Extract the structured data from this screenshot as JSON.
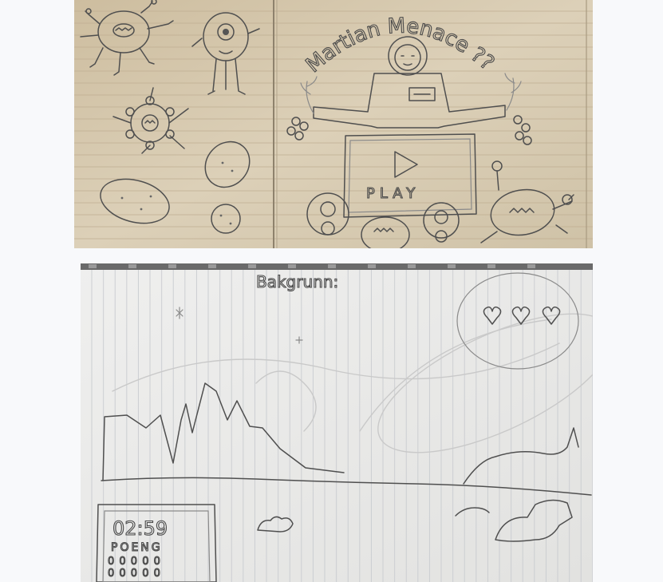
{
  "top_sketch": {
    "title": "Martian Menace ???",
    "play_label": "PLAY"
  },
  "bottom_sketch": {
    "heading": "Bakgrunn:",
    "timer": "02:59",
    "score_label": "POENG",
    "score_row_1": "0 0 0 0 0",
    "score_row_2": "0 0 0 0 0"
  },
  "colors": {
    "paper_warm": "#d8cbb0",
    "paper_cool": "#e9e9e7",
    "pencil": "#4f4f4f",
    "page_background": "#f8f9fb"
  }
}
